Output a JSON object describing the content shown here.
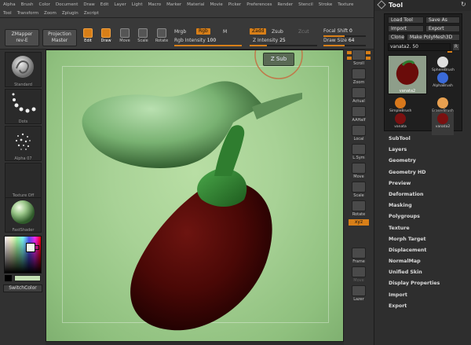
{
  "menu": {
    "row1": [
      "Alpha",
      "Brush",
      "Color",
      "Document",
      "Draw",
      "Edit",
      "Layer",
      "Light",
      "Macro",
      "Marker",
      "Material",
      "Movie",
      "Picker",
      "Preferences",
      "Render",
      "Stencil",
      "Stroke",
      "Texture"
    ],
    "row2": [
      "Tool",
      "Transform",
      "Zoom",
      "Zplugin",
      "Zscript"
    ]
  },
  "toolbar": {
    "zmapper_1": "ZMapper",
    "zmapper_2": "rev-E",
    "projection_1": "Projection",
    "projection_2": "Master",
    "edit": "Edit",
    "draw": "Draw",
    "move": "Move",
    "scale": "Scale",
    "rotate": "Rotate",
    "mrgb": "Mrgb",
    "rgb": "Rgb",
    "m": "M",
    "zadd": "Zadd",
    "zsub": "Zsub",
    "zcut": "Zcut",
    "rgb_intensity_label": "Rgb Intensity",
    "rgb_intensity_value": "100",
    "z_intensity_label": "Z Intensity",
    "z_intensity_value": "25",
    "focal_shift_label": "Focal Shift",
    "focal_shift_value": "0",
    "draw_size_label": "Draw Size",
    "draw_size_value": "64"
  },
  "left_shelf": {
    "standard": "Standard",
    "dots": "Dots",
    "alpha": "Alpha 07",
    "texture": "Texture Off",
    "material": "FastShader",
    "switch_color": "SwitchColor"
  },
  "canvas": {
    "zsub_label": "Z Sub"
  },
  "right_shelf": [
    "Scroll",
    "Zoom",
    "Actual",
    "AAHalf",
    "Local",
    "L.Sym",
    "Move",
    "Scale",
    "Rotate",
    "Frame",
    "Move",
    "Lazer"
  ],
  "right_shelf_xyz": "xyz",
  "tool": {
    "title": "Tool",
    "load": "Load Tool",
    "save": "Save As",
    "import": "Import",
    "export": "Export",
    "clone": "Clone",
    "polymesh": "Make PolyMesh3D",
    "current_name": "vanata2. 50",
    "current_r": "R",
    "thumb_caption": "vanata2",
    "items": [
      {
        "name": "SphereBrush",
        "color": "#dedede"
      },
      {
        "name": "AlphaBrush",
        "color": "#3a6ad8"
      },
      {
        "name": "SimpleBrush",
        "color": "#d8781c"
      },
      {
        "name": "EraserBrush",
        "color": "#e8a050"
      },
      {
        "name": "vanata",
        "color": "#7a1010"
      },
      {
        "name": "vanata2",
        "color": "#7a1010"
      }
    ]
  },
  "subpalettes": [
    "SubTool",
    "Layers",
    "Geometry",
    "Geometry HD",
    "Preview",
    "Deformation",
    "Masking",
    "Polygroups",
    "Texture",
    "Morph Target",
    "Displacement",
    "NormalMap",
    "Unified Skin",
    "Display Properties",
    "Import",
    "Export"
  ]
}
